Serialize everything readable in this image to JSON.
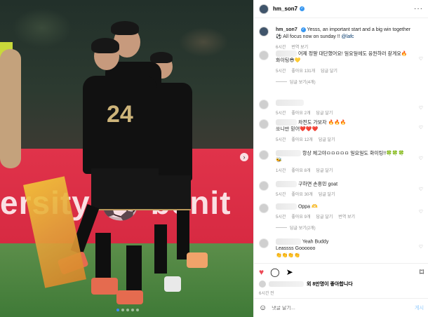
{
  "post": {
    "username": "hm_son7",
    "verified_icon": "verified-badge-icon",
    "caption": "Yesss, an important start and a big win together ⚽ All focus now on sunday !! ",
    "caption_tag": "@lafc",
    "caption_time": "6시간",
    "translate": "번역 보기",
    "banner_text": "ersity  ⚽  benit"
  },
  "comments": [
    {
      "text": "어제 정말 대단했어요! 일요일에도 응원하러 갈게요🔥",
      "text2": "화이팅😎💛",
      "time": "5시간",
      "likes": "좋아요 131개",
      "reply": "답글 달기",
      "view_replies": "답글 보기(4개)"
    },
    {
      "text": "",
      "time": "5시간",
      "likes": "좋아요 2개",
      "reply": "답글 달기"
    },
    {
      "text": "차전도 가보자 🔥🔥🔥",
      "text2": "쏘니만 믿어❤️❤️❤️",
      "time": "5시간",
      "likes": "좋아요 12개",
      "reply": "답글 달기"
    },
    {
      "text": "항상 체고야ㅁㅁㅁㅁㅁ 일요일도 화이팅!!🍀🍀🍀",
      "text2": "🐝",
      "time": "1시간",
      "likes": "좋아요 8개",
      "reply": "답글 달기"
    },
    {
      "text": "구하면 손흥민 goat",
      "time": "5시간",
      "likes": "좋아요 30개",
      "reply": "답글 달기"
    },
    {
      "text": "Oppa 🫶",
      "time": "5시간",
      "likes": "좋아요 9개",
      "reply": "답글 달기",
      "translate": "번역 보기",
      "view_replies": "답글 보기(2개)"
    },
    {
      "text": "Yeah Buddy",
      "text2": "Leassss Goooooo",
      "text3": "👏👏👏👏"
    }
  ],
  "actions": {
    "like_icon": "heart-filled-icon",
    "comment_icon": "comment-icon",
    "share_icon": "share-icon",
    "save_icon": "bookmark-icon"
  },
  "likes_text": "외 8만명이 좋아합니다",
  "post_time": "6시간 전",
  "add_comment": {
    "placeholder": "댓글 달기...",
    "post_label": "게시"
  },
  "carousel": {
    "current": 1,
    "total": 5
  },
  "colors": {
    "like": "#ed4956",
    "link": "#00376b",
    "verified": "#3897f0",
    "banner": "#e0334a"
  }
}
